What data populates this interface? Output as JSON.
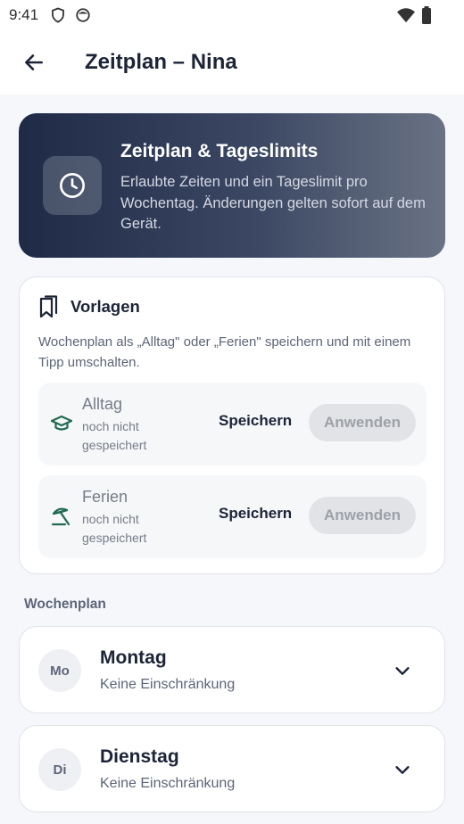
{
  "status": {
    "time": "9:41"
  },
  "appbar": {
    "title": "Zeitplan – Nina"
  },
  "hero": {
    "title": "Zeitplan & Tageslimits",
    "description": "Erlaubte Zeiten und ein Tageslimit pro Wochentag. Änderungen gelten sofort auf dem Gerät."
  },
  "vorlagen": {
    "title": "Vorlagen",
    "description": "Wochenplan als „Alltag\" oder „Ferien\" speichern und mit einem Tipp umschalten.",
    "presets": [
      {
        "name": "Alltag",
        "status": "noch nicht gespeichert",
        "save_label": "Speichern",
        "apply_label": "Anwenden",
        "icon": "graduation-cap-icon"
      },
      {
        "name": "Ferien",
        "status": "noch nicht gespeichert",
        "save_label": "Speichern",
        "apply_label": "Anwenden",
        "icon": "beach-umbrella-icon"
      }
    ]
  },
  "wochenplan": {
    "label": "Wochenplan",
    "days": [
      {
        "abbr": "Mo",
        "name": "Montag",
        "status": "Keine Einschränkung"
      },
      {
        "abbr": "Di",
        "name": "Dienstag",
        "status": "Keine Einschränkung"
      }
    ]
  },
  "colors": {
    "accent_green": "#1f6b4f",
    "hero_dark": "#1f2b46",
    "text_dark": "#1c2437"
  }
}
